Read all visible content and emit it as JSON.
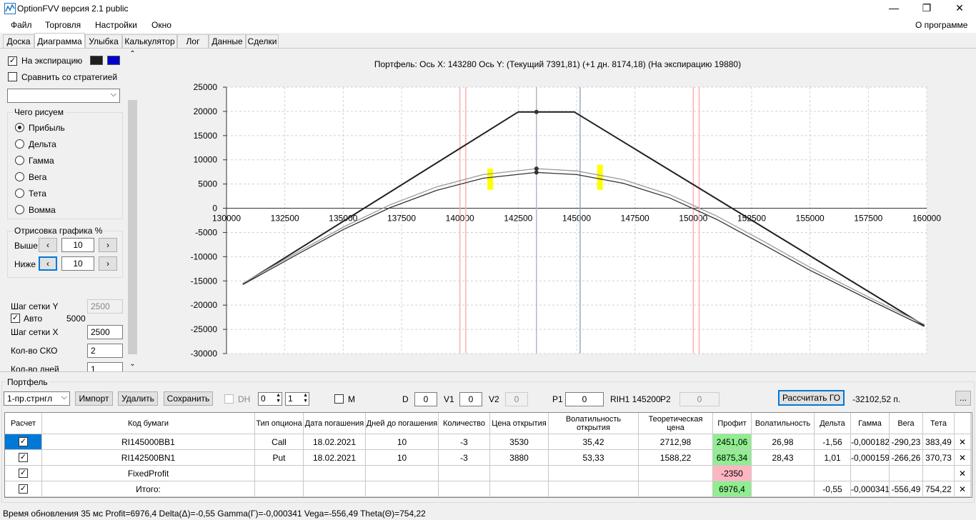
{
  "window": {
    "title": "OptionFVV версия 2.1 public",
    "minimize": "—",
    "maximize": "❐",
    "close": "✕"
  },
  "menu": {
    "items": [
      "Файл",
      "Торговля",
      "Настройки",
      "Окно"
    ],
    "about": "О программе"
  },
  "tabs": [
    "Доска",
    "Диаграмма",
    "Улыбка",
    "Калькулятор",
    "Лог",
    "Данные",
    "Сделки"
  ],
  "left": {
    "to_expiration": "На экспирацию",
    "compare": "Сравнить со стратегией",
    "swatch1": "#1f1f1f",
    "swatch2": "#0000cc",
    "draw_group": "Чего рисуем",
    "draw_options": [
      "Прибыль",
      "Дельта",
      "Гамма",
      "Вега",
      "Тета",
      "Вомма"
    ],
    "render_group": "Отрисовка графика %",
    "above_label": "Выше",
    "above_value": "10",
    "below_label": "Ниже",
    "below_value": "10",
    "grid_y_label": "Шаг сетки Y",
    "grid_y_value": "2500",
    "auto_label": "Авто",
    "auto_value": "5000",
    "grid_x_label": "Шаг сетки X",
    "grid_x_value": "2500",
    "sko_label": "Кол-во СКО",
    "sko_value": "2",
    "days_label": "Кол-во дней",
    "days_value": "1"
  },
  "chart_header": "Портфель:  Ось X:  143280  Ось Y:   (Текущий  7391,81)   (+1 дн.  8174,18)   (На экспирацию  19880)",
  "chart_data": {
    "type": "line",
    "xlim": [
      130000,
      160000
    ],
    "ylim": [
      -30000,
      25000
    ],
    "x_ticks": [
      130000,
      132500,
      135000,
      137500,
      140000,
      142500,
      145000,
      147500,
      150000,
      152500,
      155000,
      157500,
      160000
    ],
    "y_ticks": [
      25000,
      20000,
      15000,
      10000,
      5000,
      0,
      -5000,
      -10000,
      -15000,
      -20000,
      -25000,
      -30000
    ],
    "x_tick_labels": [
      "130000",
      "132500",
      "135000",
      "137500",
      "140000",
      "142500",
      "145000",
      "147500",
      "150000",
      "152500",
      "155000",
      "157500",
      "160000"
    ],
    "y_tick_labels": [
      "25000",
      "20000",
      "15000",
      "10000",
      "5000",
      "0",
      "-5000",
      "-10000",
      "-15000",
      "-20000",
      "-25000",
      "-30000"
    ],
    "series": [
      {
        "color": "#1f1f1f",
        "points": [
          [
            130700,
            -15650
          ],
          [
            142500,
            19880
          ],
          [
            144900,
            19880
          ],
          [
            159900,
            -24220
          ]
        ]
      },
      {
        "color": "#999999",
        "points": [
          [
            130700,
            -15500
          ],
          [
            133000,
            -9200
          ],
          [
            135000,
            -3900
          ],
          [
            137000,
            700
          ],
          [
            139000,
            4400
          ],
          [
            141000,
            6950
          ],
          [
            143280,
            8174
          ],
          [
            145000,
            7700
          ],
          [
            147000,
            5900
          ],
          [
            149000,
            2800
          ],
          [
            151000,
            -1600
          ],
          [
            153000,
            -6800
          ],
          [
            155000,
            -12200
          ],
          [
            157500,
            -18300
          ],
          [
            159900,
            -24000
          ]
        ]
      },
      {
        "color": "#333333",
        "points": [
          [
            130700,
            -15750
          ],
          [
            133000,
            -9600
          ],
          [
            135000,
            -4400
          ],
          [
            137000,
            100
          ],
          [
            139000,
            3700
          ],
          [
            141000,
            6200
          ],
          [
            143280,
            7392
          ],
          [
            145000,
            6950
          ],
          [
            147000,
            5150
          ],
          [
            149000,
            2100
          ],
          [
            151000,
            -2300
          ],
          [
            153000,
            -7500
          ],
          [
            155000,
            -12800
          ],
          [
            157500,
            -18800
          ],
          [
            159900,
            -24400
          ]
        ]
      }
    ],
    "markers": [
      [
        143280,
        19880
      ],
      [
        143280,
        8174
      ],
      [
        143280,
        7392
      ]
    ],
    "vlines": [
      {
        "x": 143280,
        "color": "#b0b8c8"
      },
      {
        "x": 145150,
        "color": "#9aa8c0"
      },
      {
        "x": 140250,
        "color": "#ffb0b0"
      },
      {
        "x": 140000,
        "color": "#ffb0b0"
      },
      {
        "x": 150000,
        "color": "#ffb0b0"
      },
      {
        "x": 150250,
        "color": "#ffb0b0"
      }
    ],
    "highlights": [
      {
        "x": 141300,
        "y0": 3800,
        "y1": 8200,
        "color": "#ffff00"
      },
      {
        "x": 146000,
        "y0": 3800,
        "y1": 9000,
        "color": "#ffff00"
      }
    ]
  },
  "portfolio": {
    "group_label": "Портфель",
    "strategy": "1-пр.стрнгл",
    "import": "Импорт",
    "delete": "Удалить",
    "save": "Сохранить",
    "dh": "DH",
    "spin1": "0",
    "spin2": "1",
    "m": "M",
    "d_label": "D",
    "d_value": "0",
    "v1_label": "V1",
    "v1_value": "0",
    "v2_label": "V2",
    "v2_value": "0",
    "p1_label": "P1",
    "p1_value": "0",
    "rih": "RIH1 145200",
    "p2_label": "P2",
    "p2_value": "0",
    "calc_go": "Рассчитать ГО",
    "go_value": "-32102,52 п.",
    "more": "..."
  },
  "table": {
    "headers": [
      "Расчет",
      "Код бумаги",
      "Тип опциона",
      "Дата погашения",
      "Дней до погашения",
      "Количество",
      "Цена открытия",
      "Волатильность открытия",
      "Теоретическая цена",
      "Профит",
      "Волатильность",
      "Дельта",
      "Гамма",
      "Вега",
      "Тета",
      ""
    ],
    "rows": [
      [
        "RI145000BB1",
        "Call",
        "18.02.2021",
        "10",
        "-3",
        "3530",
        "35,42",
        "2712,98",
        "2451,06",
        "26,98",
        "-1,56",
        "-0,000182",
        "-290,23",
        "383,49"
      ],
      [
        "RI142500BN1",
        "Put",
        "18.02.2021",
        "10",
        "-3",
        "3880",
        "53,33",
        "1588,22",
        "6875,34",
        "28,43",
        "1,01",
        "-0,000159",
        "-266,26",
        "370,73"
      ],
      [
        "FixedProfit",
        "",
        "",
        "",
        "",
        "",
        "",
        "",
        "-2350",
        "",
        "",
        "",
        "",
        ""
      ],
      [
        "Итого:",
        "",
        "",
        "",
        "",
        "",
        "",
        "",
        "6976,4",
        "",
        "-0,55",
        "-0,000341",
        "-556,49",
        "754,22"
      ]
    ]
  },
  "status": "Время обновления 35 мс  Profit=6976,4 Delta(Δ)=-0,55 Gamma(Γ)=-0,000341 Vega=-556,49 Theta(Θ)=754,22"
}
